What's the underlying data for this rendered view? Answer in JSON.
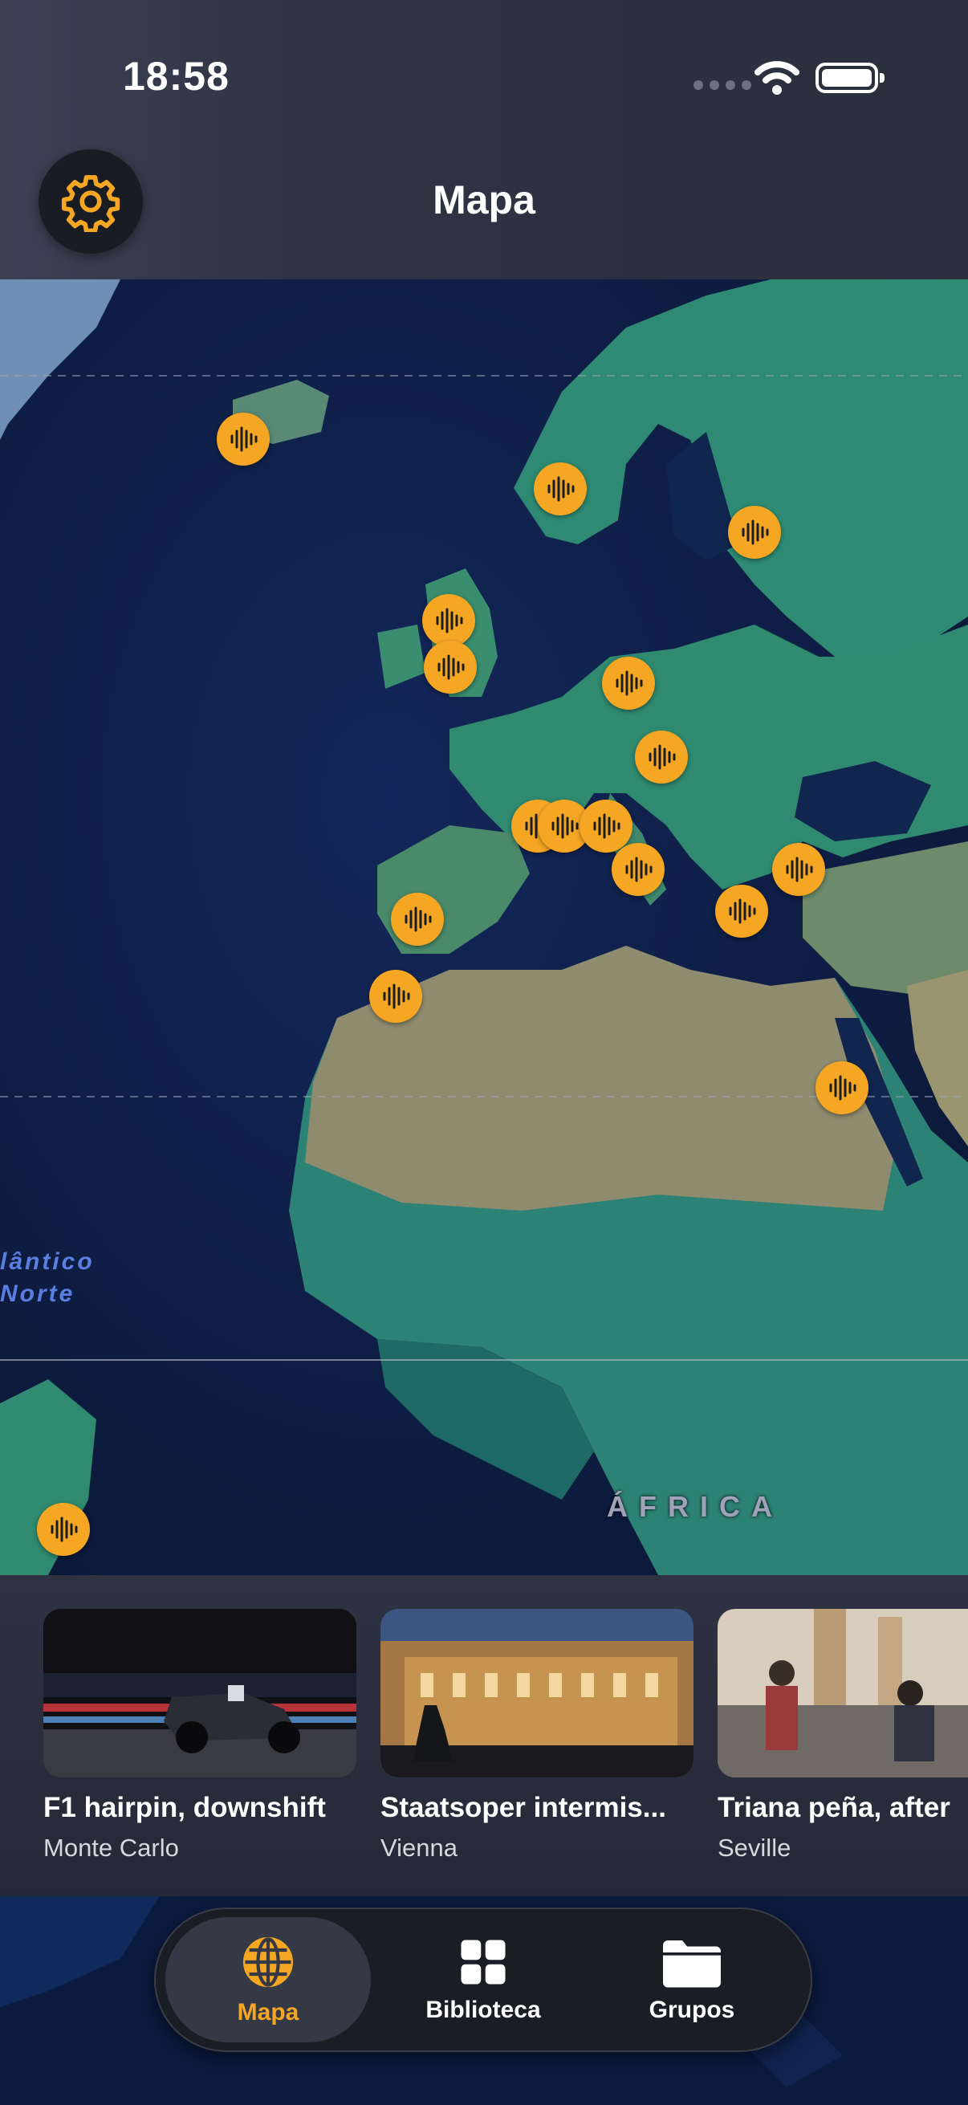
{
  "status_bar": {
    "time": "18:58"
  },
  "header": {
    "title": "Mapa",
    "settings_icon": "gear-icon"
  },
  "map": {
    "ocean_label_line1": "lântico",
    "ocean_label_line2": "Norte",
    "continent_label": "ÁFRICA",
    "pin_icon": "audio-waveform-icon",
    "record_icon": "microphone-icon"
  },
  "cards": [
    {
      "title": "F1 hairpin, downshift",
      "location": "Monte Carlo"
    },
    {
      "title": "Staatsoper intermis...",
      "location": "Vienna"
    },
    {
      "title": "Triana peña, after",
      "location": "Seville"
    }
  ],
  "tabs": [
    {
      "label": "Mapa",
      "icon": "globe-icon",
      "active": true
    },
    {
      "label": "Biblioteca",
      "icon": "grid-icon",
      "active": false
    },
    {
      "label": "Grupos",
      "icon": "folder-icon",
      "active": false
    }
  ],
  "colors": {
    "accent": "#f5a623",
    "ocean": "#0d1b3d",
    "land": "#2f7f76",
    "desert": "#8e8a6e"
  }
}
